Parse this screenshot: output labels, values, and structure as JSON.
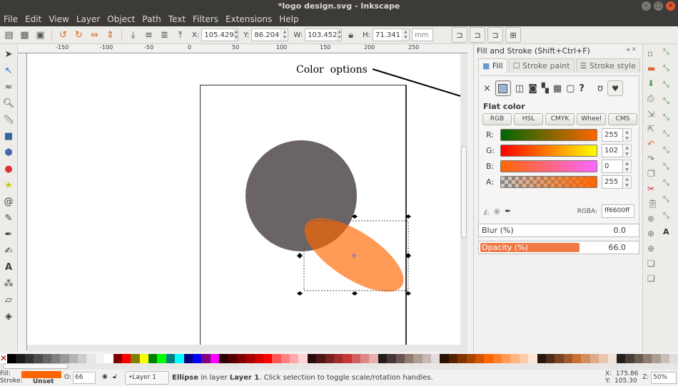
{
  "window": {
    "title": "*logo design.svg - Inkscape"
  },
  "menu": [
    "File",
    "Edit",
    "View",
    "Layer",
    "Object",
    "Path",
    "Text",
    "Filters",
    "Extensions",
    "Help"
  ],
  "toolbar": {
    "x_label": "X:",
    "x": "105.429",
    "y_label": "Y:",
    "y": "86.204",
    "w_label": "W:",
    "w": "103.452",
    "h_label": "H:",
    "h": "71.341",
    "unit": "mm"
  },
  "ruler": [
    "-150",
    "-100",
    "-50",
    "0",
    "50",
    "100",
    "150",
    "200",
    "250"
  ],
  "annotation": {
    "text": "Color  options"
  },
  "panel": {
    "title": "Fill and Stroke (Shift+Ctrl+F)",
    "tabs": [
      "Fill",
      "Stroke paint",
      "Stroke style"
    ],
    "section": "Flat color",
    "modes": [
      "RGB",
      "HSL",
      "CMYK",
      "Wheel",
      "CMS"
    ],
    "channels": [
      {
        "label": "R:",
        "value": "255"
      },
      {
        "label": "G:",
        "value": "102"
      },
      {
        "label": "B:",
        "value": "0"
      },
      {
        "label": "A:",
        "value": "255"
      }
    ],
    "rgba_label": "RGBA:",
    "rgba": "ff6600ff",
    "blur_label": "Blur (%)",
    "blur": "0.0",
    "opacity_label": "Opacity (%)",
    "opacity": "66.0",
    "opacity_fraction": 0.66
  },
  "palette": [
    "#000000",
    "#1a1a1a",
    "#333333",
    "#4d4d4d",
    "#666666",
    "#808080",
    "#999999",
    "#b3b3b3",
    "#cccccc",
    "#e6e6e6",
    "#f2f2f2",
    "#ffffff",
    "#800000",
    "#ff0000",
    "#808000",
    "#ffff00",
    "#008000",
    "#00ff00",
    "#008080",
    "#00ffff",
    "#000080",
    "#0000ff",
    "#800080",
    "#ff00ff",
    "#2b0000",
    "#550000",
    "#800000",
    "#aa0000",
    "#d40000",
    "#ff0000",
    "#ff5555",
    "#ff8080",
    "#ffaaaa",
    "#ffd5d5",
    "#280b0b",
    "#501616",
    "#782121",
    "#a02c2c",
    "#c83737",
    "#d35f5f",
    "#de8787",
    "#e9afaf",
    "#241c1c",
    "#483737",
    "#6c5353",
    "#917c6f",
    "#ac9d93",
    "#c8b7b7",
    "#e3dbdb",
    "#2b1100",
    "#552200",
    "#803300",
    "#aa4400",
    "#d45500",
    "#ff6600",
    "#ff7f2a",
    "#ff9955",
    "#ffb380",
    "#ffccaa",
    "#ffe6d5",
    "#28170b",
    "#502d16",
    "#784421",
    "#a05a2c",
    "#c87137",
    "#d38d5f",
    "#deaa87",
    "#e9c6af",
    "#f4e3d7",
    "#241f1c",
    "#483e37",
    "#6c5d53",
    "#917c6f",
    "#ac9d93",
    "#c8beb7",
    "#e3dedb"
  ],
  "status": {
    "fill_label": "Fill:",
    "stroke_label": "Stroke:",
    "stroke": "Unset",
    "fill_color": "#ff6600",
    "o_label": "O:",
    "opacity": "66",
    "layer": "•Layer 1",
    "obj": "Ellipse",
    "msg_pre": " in layer ",
    "layer_name": "Layer 1",
    "msg_post": ". Click selection to toggle scale/rotation handles.",
    "x": "X:  175.86",
    "y": "Y:  105.30",
    "z_label": "Z:",
    "zoom": "50%"
  }
}
